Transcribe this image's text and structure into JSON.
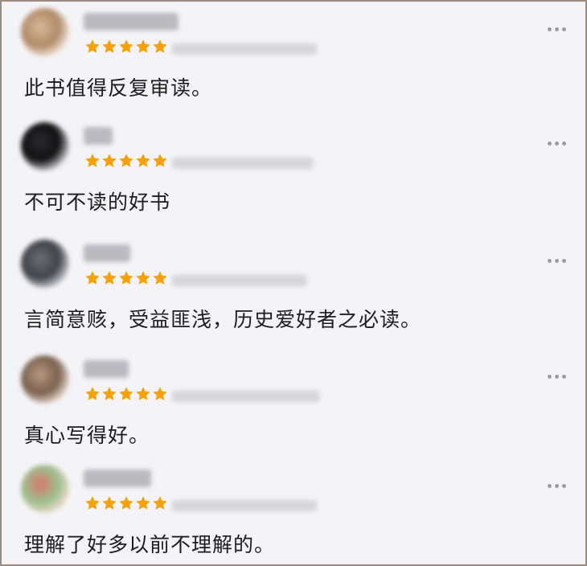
{
  "reviews": [
    {
      "avatar_colors": [
        "#f2e6dc",
        "#d8b898",
        "#b08a68"
      ],
      "rating": 5,
      "rating_max": 5,
      "text": "此书值得反复审读。"
    },
    {
      "avatar_colors": [
        "#d0d0d4",
        "#2a2a2e",
        "#111114"
      ],
      "rating": 5,
      "rating_max": 5,
      "text": "不可不读的好书"
    },
    {
      "avatar_colors": [
        "#c8ccd2",
        "#6a7078",
        "#3e434a"
      ],
      "rating": 5,
      "rating_max": 5,
      "text": "言简意赅，受益匪浅，历史爱好者之必读。"
    },
    {
      "avatar_colors": [
        "#e8dcd0",
        "#b89a80",
        "#7a6050"
      ],
      "rating": 5,
      "rating_max": 5,
      "text": "真心写得好。"
    },
    {
      "avatar_colors": [
        "#f0d8c8",
        "#d87868",
        "#9cc090"
      ],
      "rating": 5,
      "rating_max": 5,
      "text": "理解了好多以前不理解的。"
    }
  ],
  "colors": {
    "star": "#f5a20a",
    "background": "#f4f4f8",
    "text": "#1c1c1e"
  },
  "icons": {
    "more": "more-horizontal-icon",
    "star": "star-icon"
  }
}
